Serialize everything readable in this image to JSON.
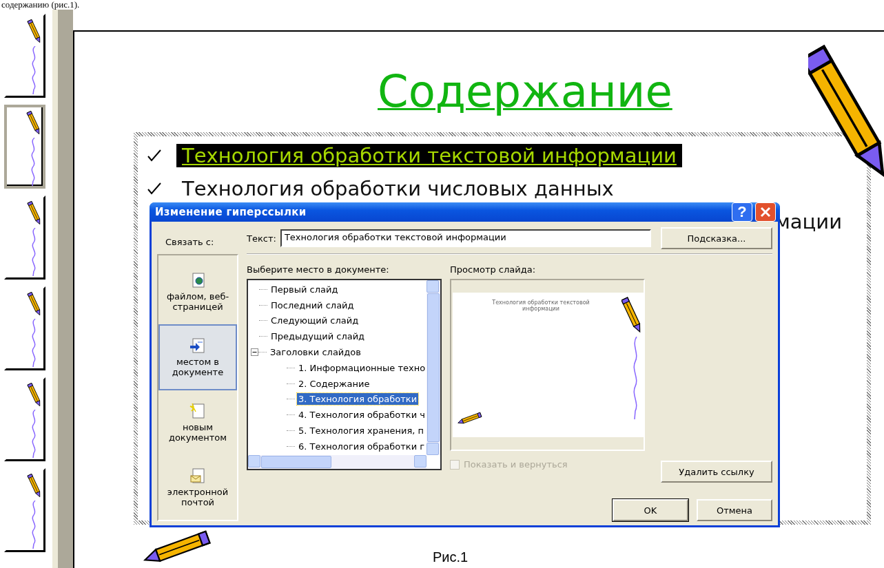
{
  "document": {
    "top_text": "содержанию (рис.1).",
    "caption": "Рис.1"
  },
  "thumbnails": [
    {
      "selected": false
    },
    {
      "selected": true
    },
    {
      "selected": false
    },
    {
      "selected": false
    },
    {
      "selected": false
    },
    {
      "selected": false
    }
  ],
  "slide": {
    "title": "Содержание",
    "bullets": [
      {
        "kind": "full",
        "text": "Технология обработки текстовой информации",
        "selected": true
      },
      {
        "kind": "full",
        "text": "Технология обработки числовых данных",
        "selected": false
      },
      {
        "kind": "partial",
        "text": "мации",
        "selected": false
      }
    ]
  },
  "dialog": {
    "title": "Изменение гиперссылки",
    "help_button": "?",
    "link_to_label": "Связать с:",
    "places": [
      {
        "label": "файлом, веб-страницей",
        "selected": false,
        "kind": "file"
      },
      {
        "label": "местом в документе",
        "selected": true,
        "kind": "place"
      },
      {
        "label": "новым документом",
        "selected": false,
        "kind": "new"
      },
      {
        "label": "электронной почтой",
        "selected": false,
        "kind": "mail"
      }
    ],
    "text_label": "Текст:",
    "text_value": "Технология обработки текстовой информации",
    "tooltip_button": "Подсказка...",
    "place_label": "Выберите место в документе:",
    "tree": [
      {
        "label": "Первый слайд",
        "selected": false
      },
      {
        "label": "Последний слайд",
        "selected": false
      },
      {
        "label": "Следующий слайд",
        "selected": false
      },
      {
        "label": "Предыдущий слайд",
        "selected": false
      },
      {
        "label": "Заголовки слайдов",
        "selected": false,
        "expanded": true,
        "children": [
          {
            "label": "1. Информационные техно",
            "selected": false
          },
          {
            "label": "2. Содержание",
            "selected": false
          },
          {
            "label": "3.  Технология обработки",
            "selected": true
          },
          {
            "label": "4. Технология обработки ч",
            "selected": false
          },
          {
            "label": "5. Технология хранения, п",
            "selected": false
          },
          {
            "label": "6. Технология обработки г",
            "selected": false
          }
        ]
      }
    ],
    "preview_label": "Просмотр слайда:",
    "preview_title": "Технология обработки текстовой информации",
    "show_and_return": {
      "label": "Показать и вернуться",
      "checked": false,
      "disabled": true
    },
    "remove_button": "Удалить ссылку",
    "ok_button": "OK",
    "cancel_button": "Отмена"
  }
}
